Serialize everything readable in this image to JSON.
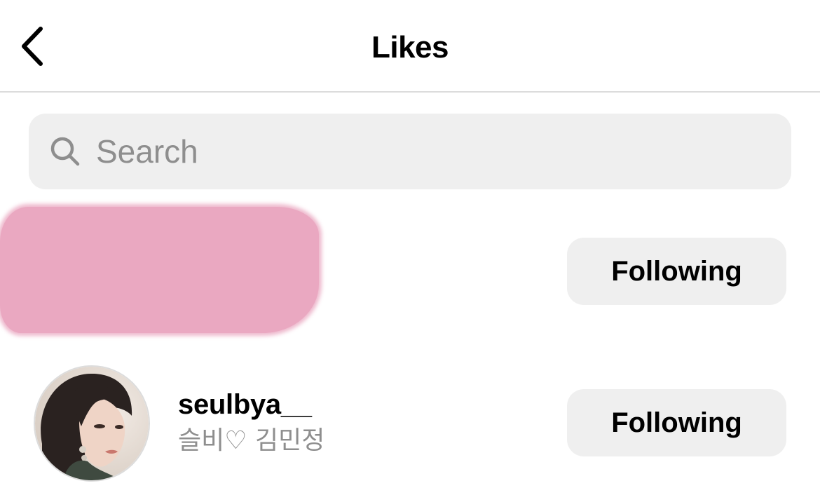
{
  "header": {
    "title": "Likes",
    "back_icon": "chevron-left-icon"
  },
  "search": {
    "placeholder": "Search",
    "value": "",
    "icon": "search-icon"
  },
  "likes": [
    {
      "username": "",
      "full_name": "",
      "redacted": true,
      "redaction_color": "#eaa8c1",
      "button_label": "Following"
    },
    {
      "username": "seulbya__",
      "full_name": "슬비♡ 김민정",
      "redacted": false,
      "button_label": "Following"
    }
  ],
  "colors": {
    "button_bg": "#efefef",
    "secondary_text": "#8e8e8e",
    "divider": "#dcdcdc"
  }
}
